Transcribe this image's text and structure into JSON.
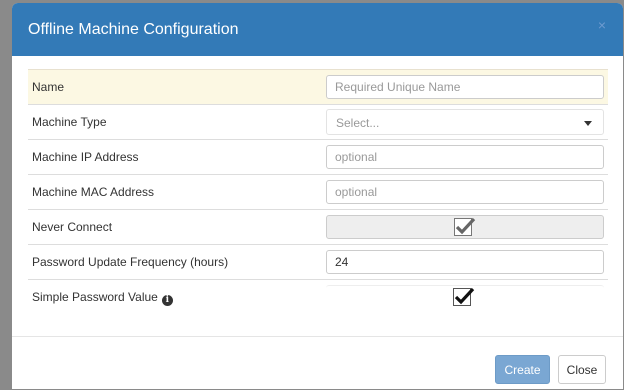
{
  "modal": {
    "title": "Offline Machine Configuration",
    "close_glyph": "×"
  },
  "form": {
    "name": {
      "label": "Name",
      "placeholder": "Required Unique Name",
      "value": ""
    },
    "machine_type": {
      "label": "Machine Type",
      "selected": "Select..."
    },
    "ip_address": {
      "label": "Machine IP Address",
      "placeholder": "optional",
      "value": ""
    },
    "mac_address": {
      "label": "Machine MAC Address",
      "placeholder": "optional",
      "value": ""
    },
    "never_connect": {
      "label": "Never Connect",
      "checked": true,
      "disabled": true
    },
    "password_frequency": {
      "label": "Password Update Frequency (hours)",
      "value": "24"
    },
    "simple_password": {
      "label": "Simple Password Value",
      "info_glyph": "i",
      "checked": true
    }
  },
  "footer": {
    "create_label": "Create",
    "close_label": "Close"
  },
  "colors": {
    "header": "#337ab7",
    "highlight_row": "#fcf8e3",
    "primary_button": "#7aa7d3"
  },
  "icons": [
    "close-icon",
    "chevron-down-icon",
    "checkmark-icon",
    "info-icon"
  ]
}
